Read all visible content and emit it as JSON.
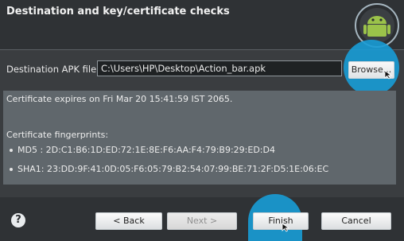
{
  "header": {
    "title": "Destination and key/certificate checks"
  },
  "destination": {
    "label": "Destination APK file:",
    "value": "C:\\Users\\HP\\Desktop\\Action_bar.apk",
    "browse_label": "Browse..."
  },
  "certificate": {
    "expires": "Certificate expires on Fri Mar 20 15:41:59 IST 2065.",
    "fingerprints_label": "Certificate fingerprints:",
    "md5": "MD5 : 2D:C1:B6:1D:ED:72:1E:8E:F6:AA:F4:79:B9:29:ED:D4",
    "sha1": "SHA1: 23:DD:9F:41:0D:05:F6:05:79:B2:54:07:99:BE:71:2F:D5:1E:06:EC"
  },
  "footer": {
    "help_label": "?",
    "back_label": "< Back",
    "next_label": "Next >",
    "finish_label": "Finish",
    "cancel_label": "Cancel"
  },
  "colors": {
    "accent": "#189cd6",
    "background": "#3a3d40",
    "message_area": "#60676c"
  },
  "icons": [
    "android-logo-icon",
    "help-icon",
    "mouse-cursor-icon"
  ]
}
